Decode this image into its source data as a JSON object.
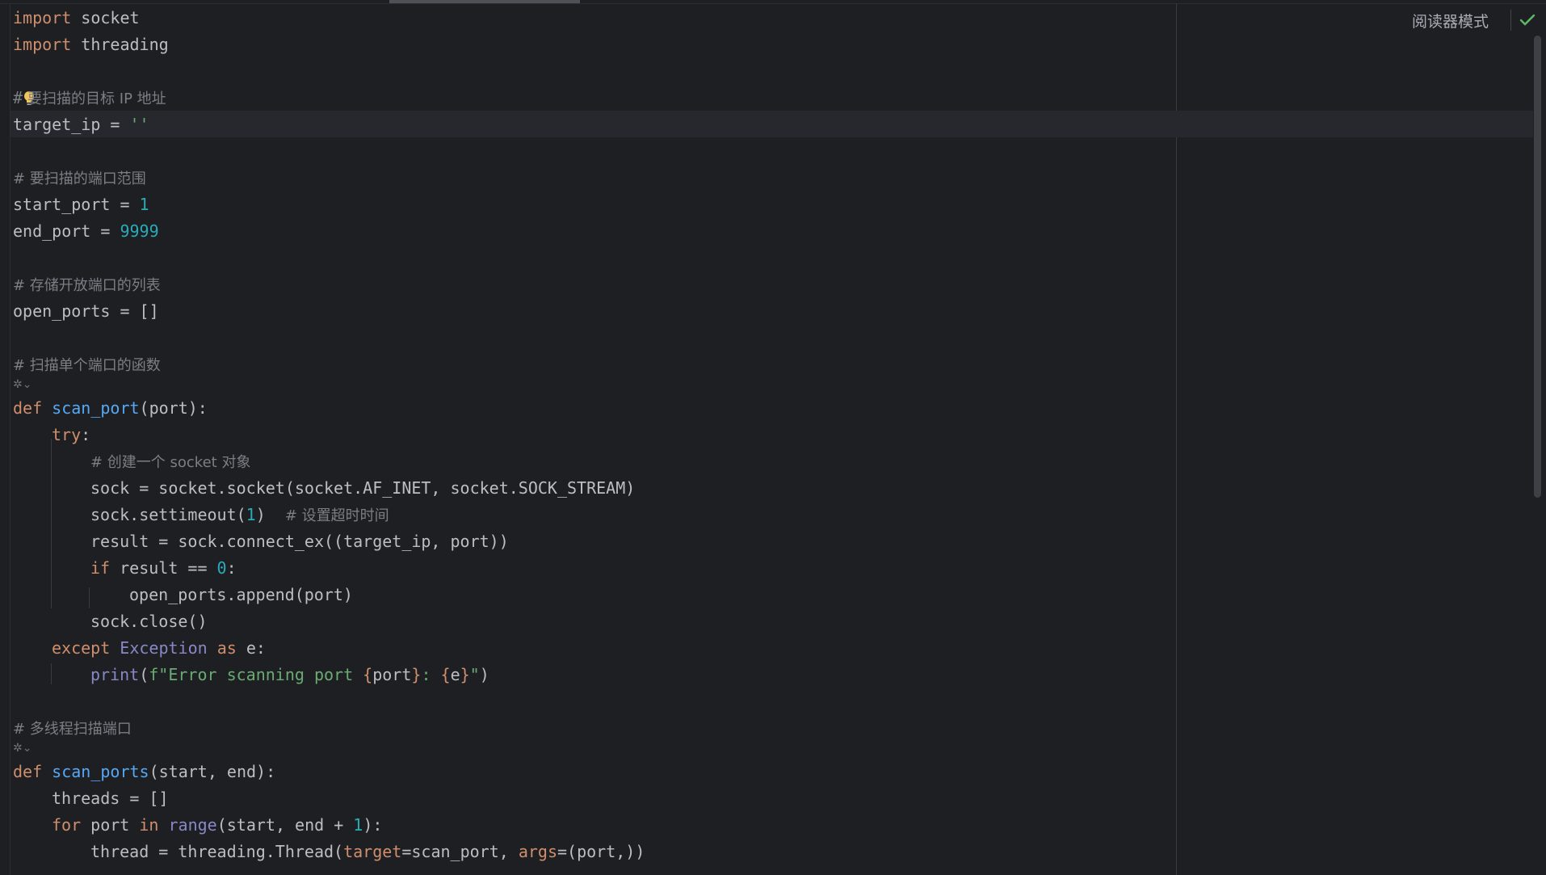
{
  "header": {
    "reader_mode_label": "阅读器模式"
  },
  "code": {
    "l1_kw": "import",
    "l1_rest": " socket",
    "l2_kw": "import",
    "l2_rest": " threading",
    "l4_hash": "#",
    "l4_comment": "要扫描的目标 IP 地址",
    "l5_a": "target_ip = ",
    "l5_str": "''",
    "l7_comment": "# 要扫描的端口范围",
    "l8_a": "start_port = ",
    "l8_num": "1",
    "l9_a": "end_port = ",
    "l9_num": "9999",
    "l11_comment": "# 存储开放端口的列表",
    "l12_a": "open_ports = []",
    "l14_comment": "# 扫描单个端口的函数",
    "l15_kw": "def",
    "l15_fn": "scan_port",
    "l15_rest": "(port):",
    "l16_kw": "try",
    "l16_rest": ":",
    "l17_comment": "# 创建一个 socket 对象",
    "l18_a": "sock = socket.socket(socket.AF_INET, socket.SOCK_STREAM)",
    "l19_a": "sock.settimeout(",
    "l19_num": "1",
    "l19_b": ")  ",
    "l19_comment": "# 设置超时时间",
    "l20_a": "result = sock.connect_ex((target_ip, port))",
    "l21_kw": "if",
    "l21_a": " result == ",
    "l21_num": "0",
    "l21_b": ":",
    "l22_a": "open_ports.append(port)",
    "l23_a": "sock.close()",
    "l24_kw": "except",
    "l24_cls": " Exception",
    "l24_kw2": " as",
    "l24_rest": " e:",
    "l25_bi": "print",
    "l25_a": "(",
    "l25_str1": "f\"Error scanning port ",
    "l25_br1": "{",
    "l25_var1": "port",
    "l25_br2": "}",
    "l25_str2": ": ",
    "l25_br3": "{",
    "l25_var2": "e",
    "l25_br4": "}",
    "l25_str3": "\"",
    "l25_b": ")",
    "l27_comment": "# 多线程扫描端口",
    "l28_kw": "def",
    "l28_fn": "scan_ports",
    "l28_rest": "(start, end):",
    "l29_a": "threads = []",
    "l30_kw": "for",
    "l30_a": " port ",
    "l30_kw2": "in",
    "l30_bi": " range",
    "l30_b": "(start, end + ",
    "l30_num": "1",
    "l30_c": "):",
    "l31_a": "thread = threading.Thread(",
    "l31_kw1": "target",
    "l31_b": "=scan_port, ",
    "l31_kw2": "args",
    "l31_c": "=(port,))"
  },
  "colors": {
    "background": "#1e1f22",
    "keyword": "#cf8e6d",
    "function": "#56a8f5",
    "number": "#2aacb8",
    "string": "#6aab73",
    "comment": "#7a7e85",
    "builtin": "#8888c6",
    "check": "#5fb865"
  }
}
